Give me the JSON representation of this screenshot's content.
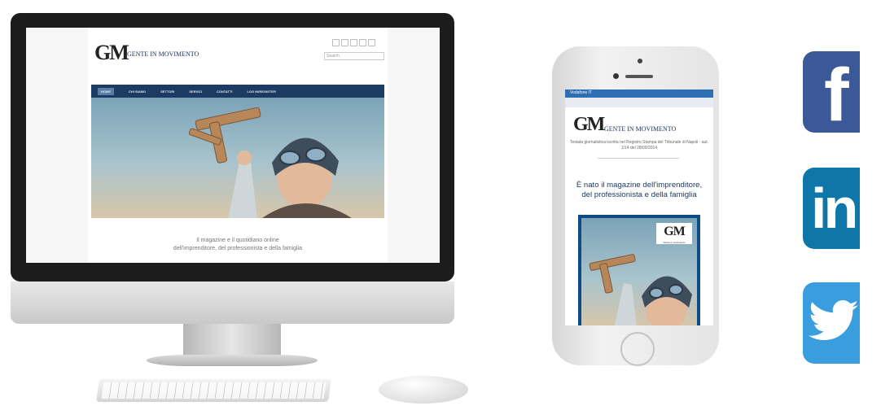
{
  "desktop": {
    "logo_mark": "GM",
    "logo_tagline": "GENTE IN MOVIMENTO",
    "search_placeholder": "Search",
    "nav": [
      "HOME",
      "CHI SIAMO",
      "SETTORI",
      "SERVIZI",
      "CONTATTI",
      "LOG IN/REGISTER"
    ],
    "tagline_line1": "Il magazine e il quotidiano online",
    "tagline_line2": "dell'imprenditore, del professionista e della famiglia"
  },
  "mobile": {
    "status": "Vodafone IT",
    "logo_mark": "GM",
    "logo_tagline": "GENTE IN MOVIMENTO",
    "registration": "Testata giornalistica iscritta nel Registro Stampa del Tribunale di Napoli - aut. 1/14 del 28/09/2014",
    "headline_line1": "È nato il magazine dell'imprenditore,",
    "headline_line2": "del professionista e della famiglia",
    "cover_logo": "GM",
    "cover_tag": "Gente in movimento"
  },
  "social": {
    "facebook_glyph": "f",
    "linkedin_glyph": "in",
    "icons": [
      "facebook-icon",
      "linkedin-icon",
      "twitter-icon"
    ]
  },
  "colors": {
    "navy": "#1b3b63",
    "facebook": "#3b5998",
    "linkedin": "#0e76a8",
    "twitter": "#3a9ede"
  }
}
